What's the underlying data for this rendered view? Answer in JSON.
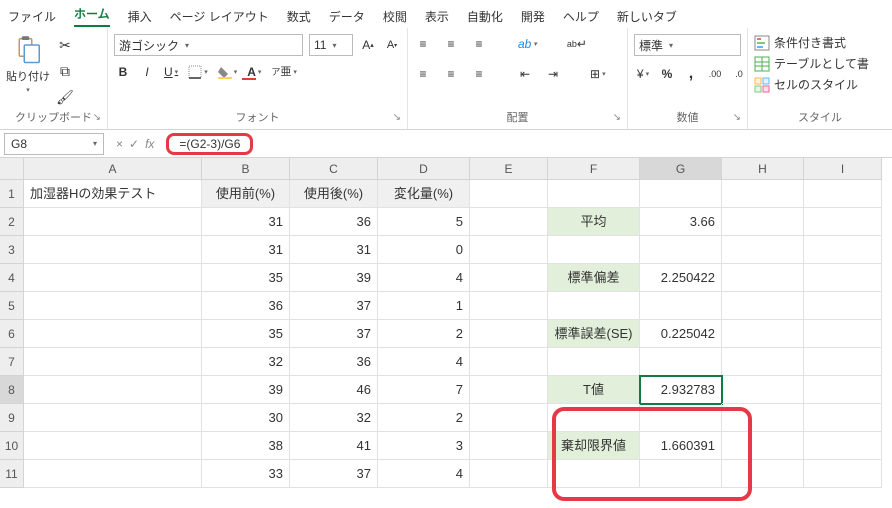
{
  "menu": {
    "file": "ファイル",
    "home": "ホーム",
    "insert": "挿入",
    "pagelayout": "ページ レイアウト",
    "formulas": "数式",
    "data": "データ",
    "review": "校閲",
    "view": "表示",
    "automate": "自動化",
    "developer": "開発",
    "help": "ヘルプ",
    "newtab": "新しいタブ"
  },
  "ribbon": {
    "clipboard": {
      "paste": "貼り付け",
      "label": "クリップボード"
    },
    "font": {
      "name": "游ゴシック",
      "size": "11",
      "label": "フォント",
      "bold": "B",
      "italic": "I",
      "under": "U",
      "ruby": "ア"
    },
    "align": {
      "label": "配置",
      "wrap_icon": "ab"
    },
    "number": {
      "format": "標準",
      "label": "数値",
      "pct": "%",
      "comma": ",",
      "yen": "¥"
    },
    "styles": {
      "cond": "条件付き書式",
      "table": "テーブルとして書",
      "cell": "セルのスタイル",
      "label": "スタイル"
    }
  },
  "formula_bar": {
    "namebox": "G8",
    "cancel": "×",
    "enter": "✓",
    "fx": "fx",
    "formula": "=(G2-3)/G6"
  },
  "columns": [
    "",
    "A",
    "B",
    "C",
    "D",
    "E",
    "F",
    "G",
    "H",
    "I"
  ],
  "rows": [
    "1",
    "2",
    "3",
    "4",
    "5",
    "6",
    "7",
    "8",
    "9",
    "10",
    "11"
  ],
  "cells": {
    "A1": "加湿器Hの効果テスト",
    "B1": "使用前(%)",
    "C1": "使用後(%)",
    "D1": "変化量(%)",
    "B2": "31",
    "C2": "36",
    "D2": "5",
    "B3": "31",
    "C3": "31",
    "D3": "0",
    "B4": "35",
    "C4": "39",
    "D4": "4",
    "B5": "36",
    "C5": "37",
    "D5": "1",
    "B6": "35",
    "C6": "37",
    "D6": "2",
    "B7": "32",
    "C7": "36",
    "D7": "4",
    "B8": "39",
    "C8": "46",
    "D8": "7",
    "B9": "30",
    "C9": "32",
    "D9": "2",
    "B10": "38",
    "C10": "41",
    "D10": "3",
    "B11": "33",
    "C11": "37",
    "D11": "4",
    "F2": "平均",
    "G2": "3.66",
    "F4": "標準偏差",
    "G4": "2.250422",
    "F6": "標準誤差(SE)",
    "G6": "0.225042",
    "F8": "T値",
    "G8": "2.932783",
    "F10": "棄却限界値",
    "G10": "1.660391"
  }
}
